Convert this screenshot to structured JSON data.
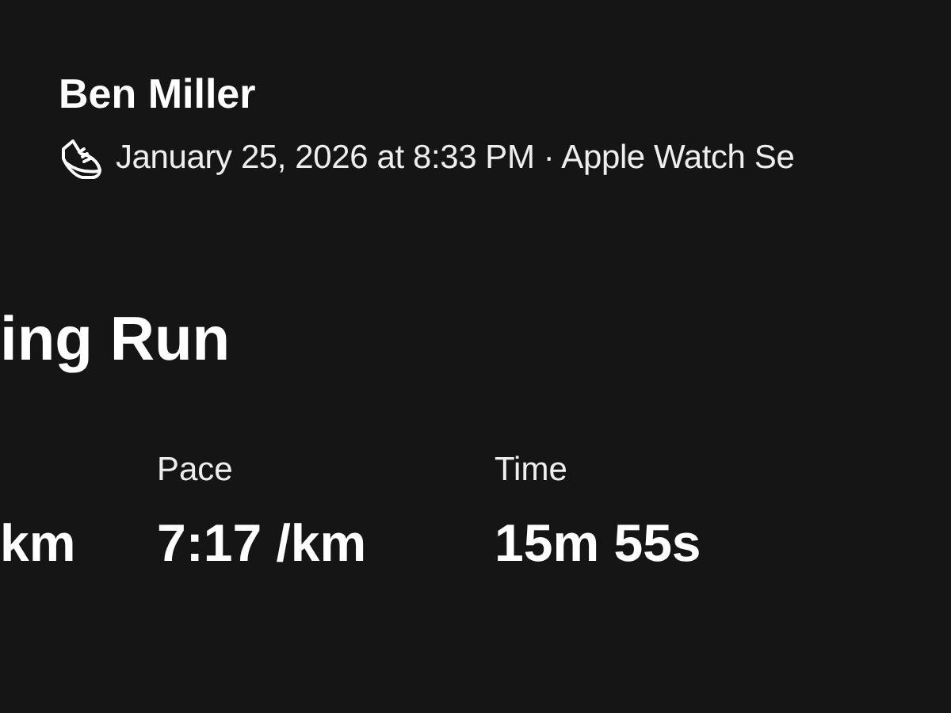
{
  "athlete": {
    "name": "Ben Miller",
    "meta": "January 25, 2026 at 8:33 PM · Apple Watch Se"
  },
  "activity": {
    "title": "ing Run"
  },
  "stats": [
    {
      "value": "km"
    },
    {
      "label": "Pace",
      "value": "7:17 /km"
    },
    {
      "label": "Time",
      "value": "15m 55s"
    }
  ]
}
